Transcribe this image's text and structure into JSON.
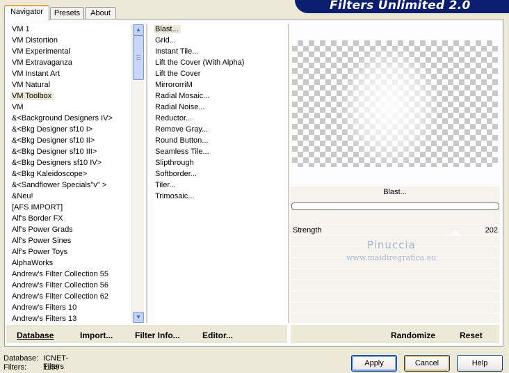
{
  "app": {
    "title": "Filters Unlimited 2.0"
  },
  "tabs": [
    "Navigator",
    "Presets",
    "About"
  ],
  "categories": [
    "VM 1",
    "VM Distortion",
    "VM Experimental",
    "VM Extravaganza",
    "VM Instant Art",
    "VM Natural",
    "VM Toolbox",
    "VM",
    "&<Background Designers IV>",
    "&<Bkg Designer sf10 I>",
    "&<Bkg Designer sf10 II>",
    "&<Bkg Designer sf10 III>",
    "&<Bkg Designers sf10 IV>",
    "&<Bkg Kaleidoscope>",
    "&<Sandflower Specials\"v\" >",
    "&Neu!",
    "[AFS IMPORT]",
    "Alf's Border FX",
    "Alf's Power Grads",
    "Alf's Power Sines",
    "Alf's Power Toys",
    "AlphaWorks",
    "Andrew's Filter Collection 55",
    "Andrew's Filter Collection 56",
    "Andrew's Filter Collection 62",
    "Andrew's Filters 10",
    "Andrew's Filters 13"
  ],
  "selected_category": "VM Toolbox",
  "filters": [
    "Blast...",
    "Grid...",
    "Instant Tile...",
    "Lift the Cover (With Alpha)",
    "Lift the Cover",
    "MirrororriM",
    "Radial Mosaic...",
    "Radial Noise...",
    "Reductor...",
    "Remove Gray...",
    "Round Button...",
    "Seamless Tile...",
    "Slipthrough",
    "Softborder...",
    "Tiler...",
    "Trimosaic..."
  ],
  "selected_filter": "Blast...",
  "preview": {
    "filter_name": "Blast...",
    "progress": 0
  },
  "params": [
    {
      "label": "Strength",
      "value": "202"
    }
  ],
  "watermark": {
    "name": "Pinuccia",
    "url": "www.maidiregrafica.eu"
  },
  "bottom_links": {
    "database": "Database",
    "import": "Import...",
    "filter_info": "Filter Info...",
    "editor": "Editor...",
    "randomize": "Randomize",
    "reset": "Reset"
  },
  "status": {
    "database_label": "Database:",
    "database_value": "ICNET-Filters",
    "filters_label": "Filters:",
    "filters_value": "1159"
  },
  "buttons": {
    "apply": "Apply",
    "cancel": "Cancel",
    "help": "Help"
  },
  "colors": {
    "banner": "#0a1e6e",
    "window": "#ece9d8",
    "tab_highlight": "#e8a33d"
  }
}
